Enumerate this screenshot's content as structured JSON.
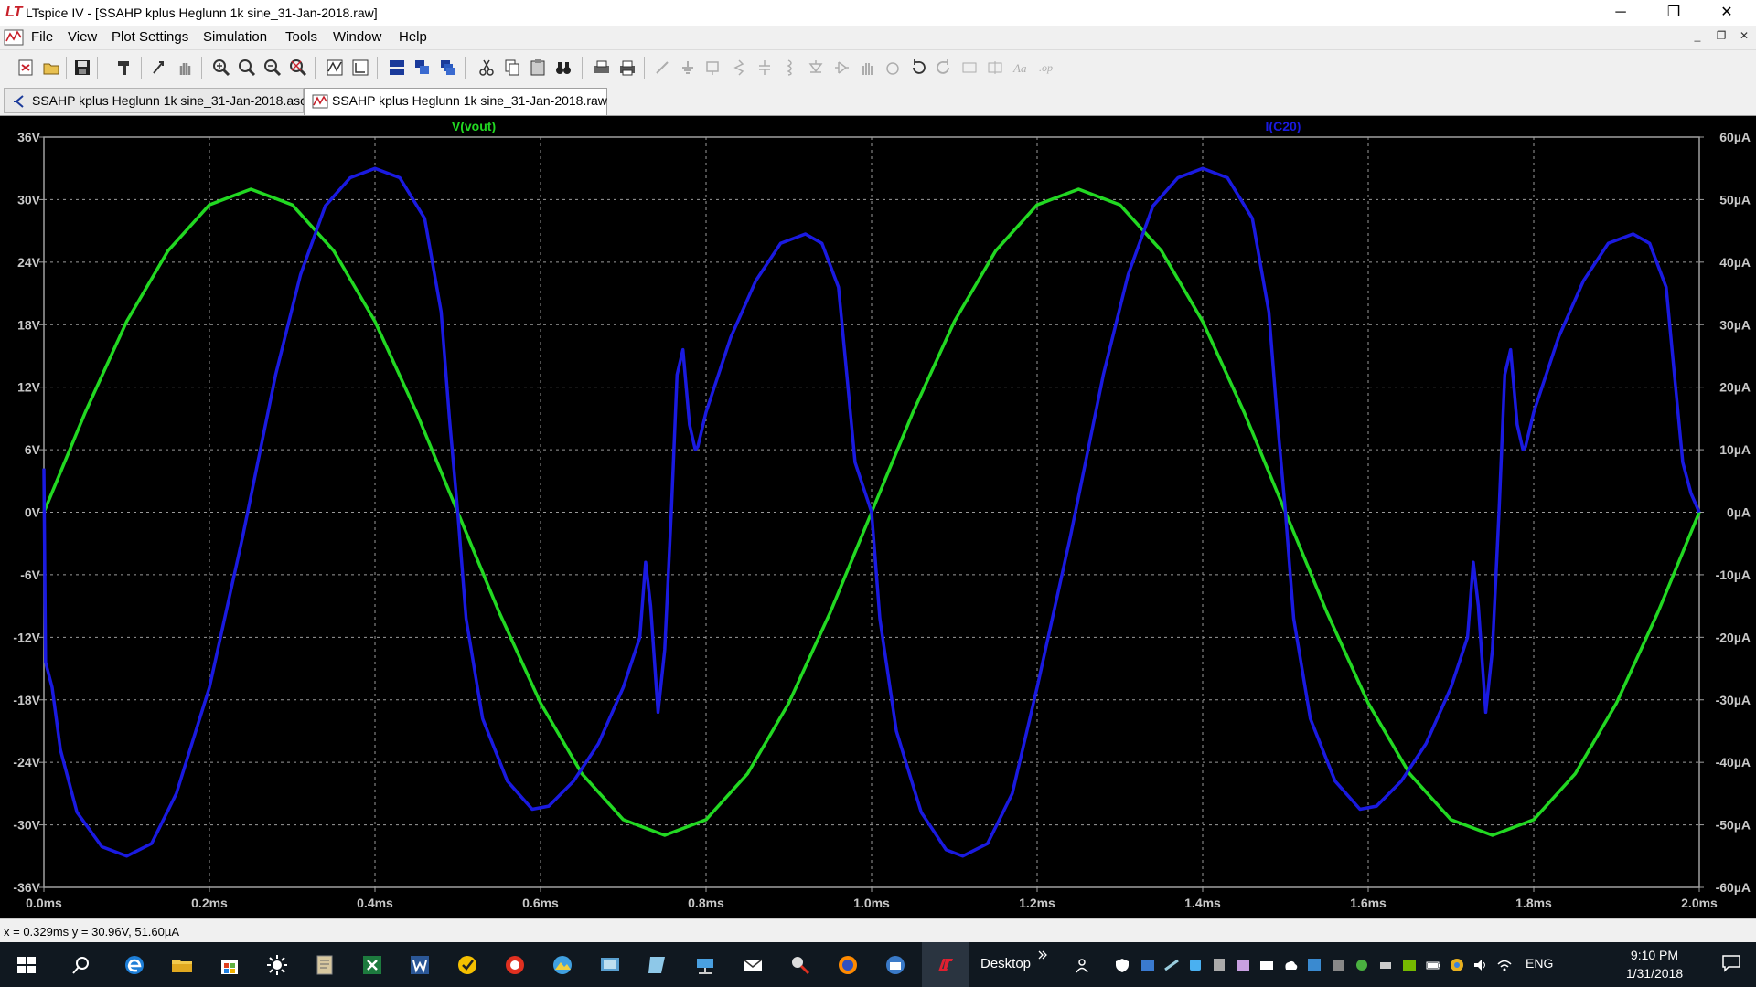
{
  "window": {
    "title": "LTspice IV - [SSAHP kplus Heglunn 1k sine_31-Jan-2018.raw]",
    "app_icon": "LT",
    "controls": {
      "minimize": "─",
      "maximize": "❐",
      "close": "✕"
    }
  },
  "menu": {
    "items": [
      "File",
      "View",
      "Plot Settings",
      "Simulation",
      "Tools",
      "Window",
      "Help"
    ],
    "mdi_controls": {
      "minimize": "_",
      "restore": "❐",
      "close": "✕"
    }
  },
  "tabs": [
    {
      "label": "SSAHP kplus Heglunn 1k sine_31-Jan-2018.asc",
      "icon": "schematic-icon",
      "active": false
    },
    {
      "label": "SSAHP kplus Heglunn 1k sine_31-Jan-2018.raw",
      "icon": "waveform-icon",
      "active": true
    }
  ],
  "status": {
    "readout": "x = 0.329ms    y = 30.96V, 51.60µA"
  },
  "chart_data": {
    "type": "line",
    "background": "#000000",
    "grid": true,
    "x_range": [
      0,
      2.0
    ],
    "x_unit": "ms",
    "x_ticks": [
      0,
      0.2,
      0.4,
      0.6,
      0.8,
      1.0,
      1.2,
      1.4,
      1.6,
      1.8,
      2.0
    ],
    "x_tick_labels": [
      "0.0ms",
      "0.2ms",
      "0.4ms",
      "0.6ms",
      "0.8ms",
      "1.0ms",
      "1.2ms",
      "1.4ms",
      "1.6ms",
      "1.8ms",
      "2.0ms"
    ],
    "left_axis": {
      "range": [
        -36,
        36
      ],
      "ticks": [
        36,
        30,
        24,
        18,
        12,
        6,
        0,
        -6,
        -12,
        -18,
        -24,
        -30,
        -36
      ],
      "tick_labels": [
        "36V",
        "30V",
        "24V",
        "18V",
        "12V",
        "6V",
        "0V",
        "-6V",
        "-12V",
        "-18V",
        "-24V",
        "-30V",
        "-36V"
      ]
    },
    "right_axis": {
      "range": [
        -60,
        60
      ],
      "ticks": [
        60,
        50,
        40,
        30,
        20,
        10,
        0,
        -10,
        -20,
        -30,
        -40,
        -50,
        -60
      ],
      "tick_labels": [
        "60µA",
        "50µA",
        "40µA",
        "30µA",
        "20µA",
        "10µA",
        "0µA",
        "-10µA",
        "-20µA",
        "-30µA",
        "-40µA",
        "-50µA",
        "-60µA"
      ]
    },
    "series": [
      {
        "name": "V(vout)",
        "color": "#22d822",
        "axis": "left",
        "points": [
          [
            0,
            0
          ],
          [
            0.05,
            9.6
          ],
          [
            0.1,
            18.3
          ],
          [
            0.15,
            25.1
          ],
          [
            0.2,
            29.5
          ],
          [
            0.25,
            31.0
          ],
          [
            0.3,
            29.5
          ],
          [
            0.35,
            25.1
          ],
          [
            0.4,
            18.3
          ],
          [
            0.45,
            9.6
          ],
          [
            0.5,
            0
          ],
          [
            0.55,
            -9.6
          ],
          [
            0.6,
            -18.3
          ],
          [
            0.65,
            -25.1
          ],
          [
            0.7,
            -29.5
          ],
          [
            0.75,
            -31.0
          ],
          [
            0.8,
            -29.5
          ],
          [
            0.85,
            -25.1
          ],
          [
            0.9,
            -18.3
          ],
          [
            0.95,
            -9.6
          ],
          [
            1.0,
            0
          ],
          [
            1.05,
            9.6
          ],
          [
            1.1,
            18.3
          ],
          [
            1.15,
            25.1
          ],
          [
            1.2,
            29.5
          ],
          [
            1.25,
            31.0
          ],
          [
            1.3,
            29.5
          ],
          [
            1.35,
            25.1
          ],
          [
            1.4,
            18.3
          ],
          [
            1.45,
            9.6
          ],
          [
            1.5,
            0
          ],
          [
            1.55,
            -9.6
          ],
          [
            1.6,
            -18.3
          ],
          [
            1.65,
            -25.1
          ],
          [
            1.7,
            -29.5
          ],
          [
            1.75,
            -31.0
          ],
          [
            1.8,
            -29.5
          ],
          [
            1.85,
            -25.1
          ],
          [
            1.9,
            -18.3
          ],
          [
            1.95,
            -9.6
          ],
          [
            2.0,
            0
          ]
        ]
      },
      {
        "name": "I(C20)",
        "color": "#1a1ae0",
        "axis": "right",
        "points": [
          [
            0,
            7
          ],
          [
            0.002,
            -24
          ],
          [
            0.01,
            -28
          ],
          [
            0.02,
            -38
          ],
          [
            0.04,
            -48
          ],
          [
            0.07,
            -53.5
          ],
          [
            0.1,
            -55
          ],
          [
            0.13,
            -53
          ],
          [
            0.16,
            -45
          ],
          [
            0.2,
            -28
          ],
          [
            0.24,
            -4
          ],
          [
            0.28,
            22
          ],
          [
            0.31,
            38
          ],
          [
            0.34,
            49
          ],
          [
            0.37,
            53.5
          ],
          [
            0.4,
            55
          ],
          [
            0.43,
            53.5
          ],
          [
            0.46,
            47
          ],
          [
            0.48,
            32
          ],
          [
            0.49,
            15
          ],
          [
            0.5,
            0
          ],
          [
            0.51,
            -17
          ],
          [
            0.53,
            -33
          ],
          [
            0.56,
            -43
          ],
          [
            0.59,
            -47.5
          ],
          [
            0.61,
            -47
          ],
          [
            0.64,
            -43
          ],
          [
            0.67,
            -37
          ],
          [
            0.7,
            -28
          ],
          [
            0.72,
            -20
          ],
          [
            0.727,
            -8
          ],
          [
            0.733,
            -15
          ],
          [
            0.742,
            -32
          ],
          [
            0.75,
            -22
          ],
          [
            0.758,
            0
          ],
          [
            0.765,
            22
          ],
          [
            0.772,
            26
          ],
          [
            0.78,
            14
          ],
          [
            0.787,
            10
          ],
          [
            0.79,
            10.5
          ],
          [
            0.8,
            16
          ],
          [
            0.83,
            28
          ],
          [
            0.86,
            37
          ],
          [
            0.89,
            43
          ],
          [
            0.92,
            44.5
          ],
          [
            0.94,
            43
          ],
          [
            0.96,
            36
          ],
          [
            0.97,
            22
          ],
          [
            0.98,
            8
          ],
          [
            1.0,
            0
          ],
          [
            1.01,
            -17
          ],
          [
            1.03,
            -35
          ],
          [
            1.06,
            -48
          ],
          [
            1.09,
            -54
          ],
          [
            1.11,
            -55
          ],
          [
            1.14,
            -53
          ],
          [
            1.17,
            -45
          ],
          [
            1.2,
            -28
          ],
          [
            1.24,
            -4
          ],
          [
            1.28,
            22
          ],
          [
            1.31,
            38
          ],
          [
            1.34,
            49
          ],
          [
            1.37,
            53.5
          ],
          [
            1.4,
            55
          ],
          [
            1.43,
            53.5
          ],
          [
            1.46,
            47
          ],
          [
            1.48,
            32
          ],
          [
            1.49,
            15
          ],
          [
            1.5,
            0
          ],
          [
            1.51,
            -17
          ],
          [
            1.53,
            -33
          ],
          [
            1.56,
            -43
          ],
          [
            1.59,
            -47.5
          ],
          [
            1.61,
            -47
          ],
          [
            1.64,
            -43
          ],
          [
            1.67,
            -37
          ],
          [
            1.7,
            -28
          ],
          [
            1.72,
            -20
          ],
          [
            1.727,
            -8
          ],
          [
            1.733,
            -15
          ],
          [
            1.742,
            -32
          ],
          [
            1.75,
            -22
          ],
          [
            1.758,
            0
          ],
          [
            1.765,
            22
          ],
          [
            1.772,
            26
          ],
          [
            1.78,
            14
          ],
          [
            1.787,
            10
          ],
          [
            1.79,
            10.5
          ],
          [
            1.8,
            16
          ],
          [
            1.83,
            28
          ],
          [
            1.86,
            37
          ],
          [
            1.89,
            43
          ],
          [
            1.92,
            44.5
          ],
          [
            1.94,
            43
          ],
          [
            1.96,
            36
          ],
          [
            1.97,
            22
          ],
          [
            1.98,
            8
          ],
          [
            1.99,
            3
          ],
          [
            2.0,
            0
          ]
        ]
      }
    ]
  },
  "taskbar": {
    "desktop_label": "Desktop",
    "language": "ENG",
    "time": "9:10 PM",
    "date": "1/31/2018"
  }
}
